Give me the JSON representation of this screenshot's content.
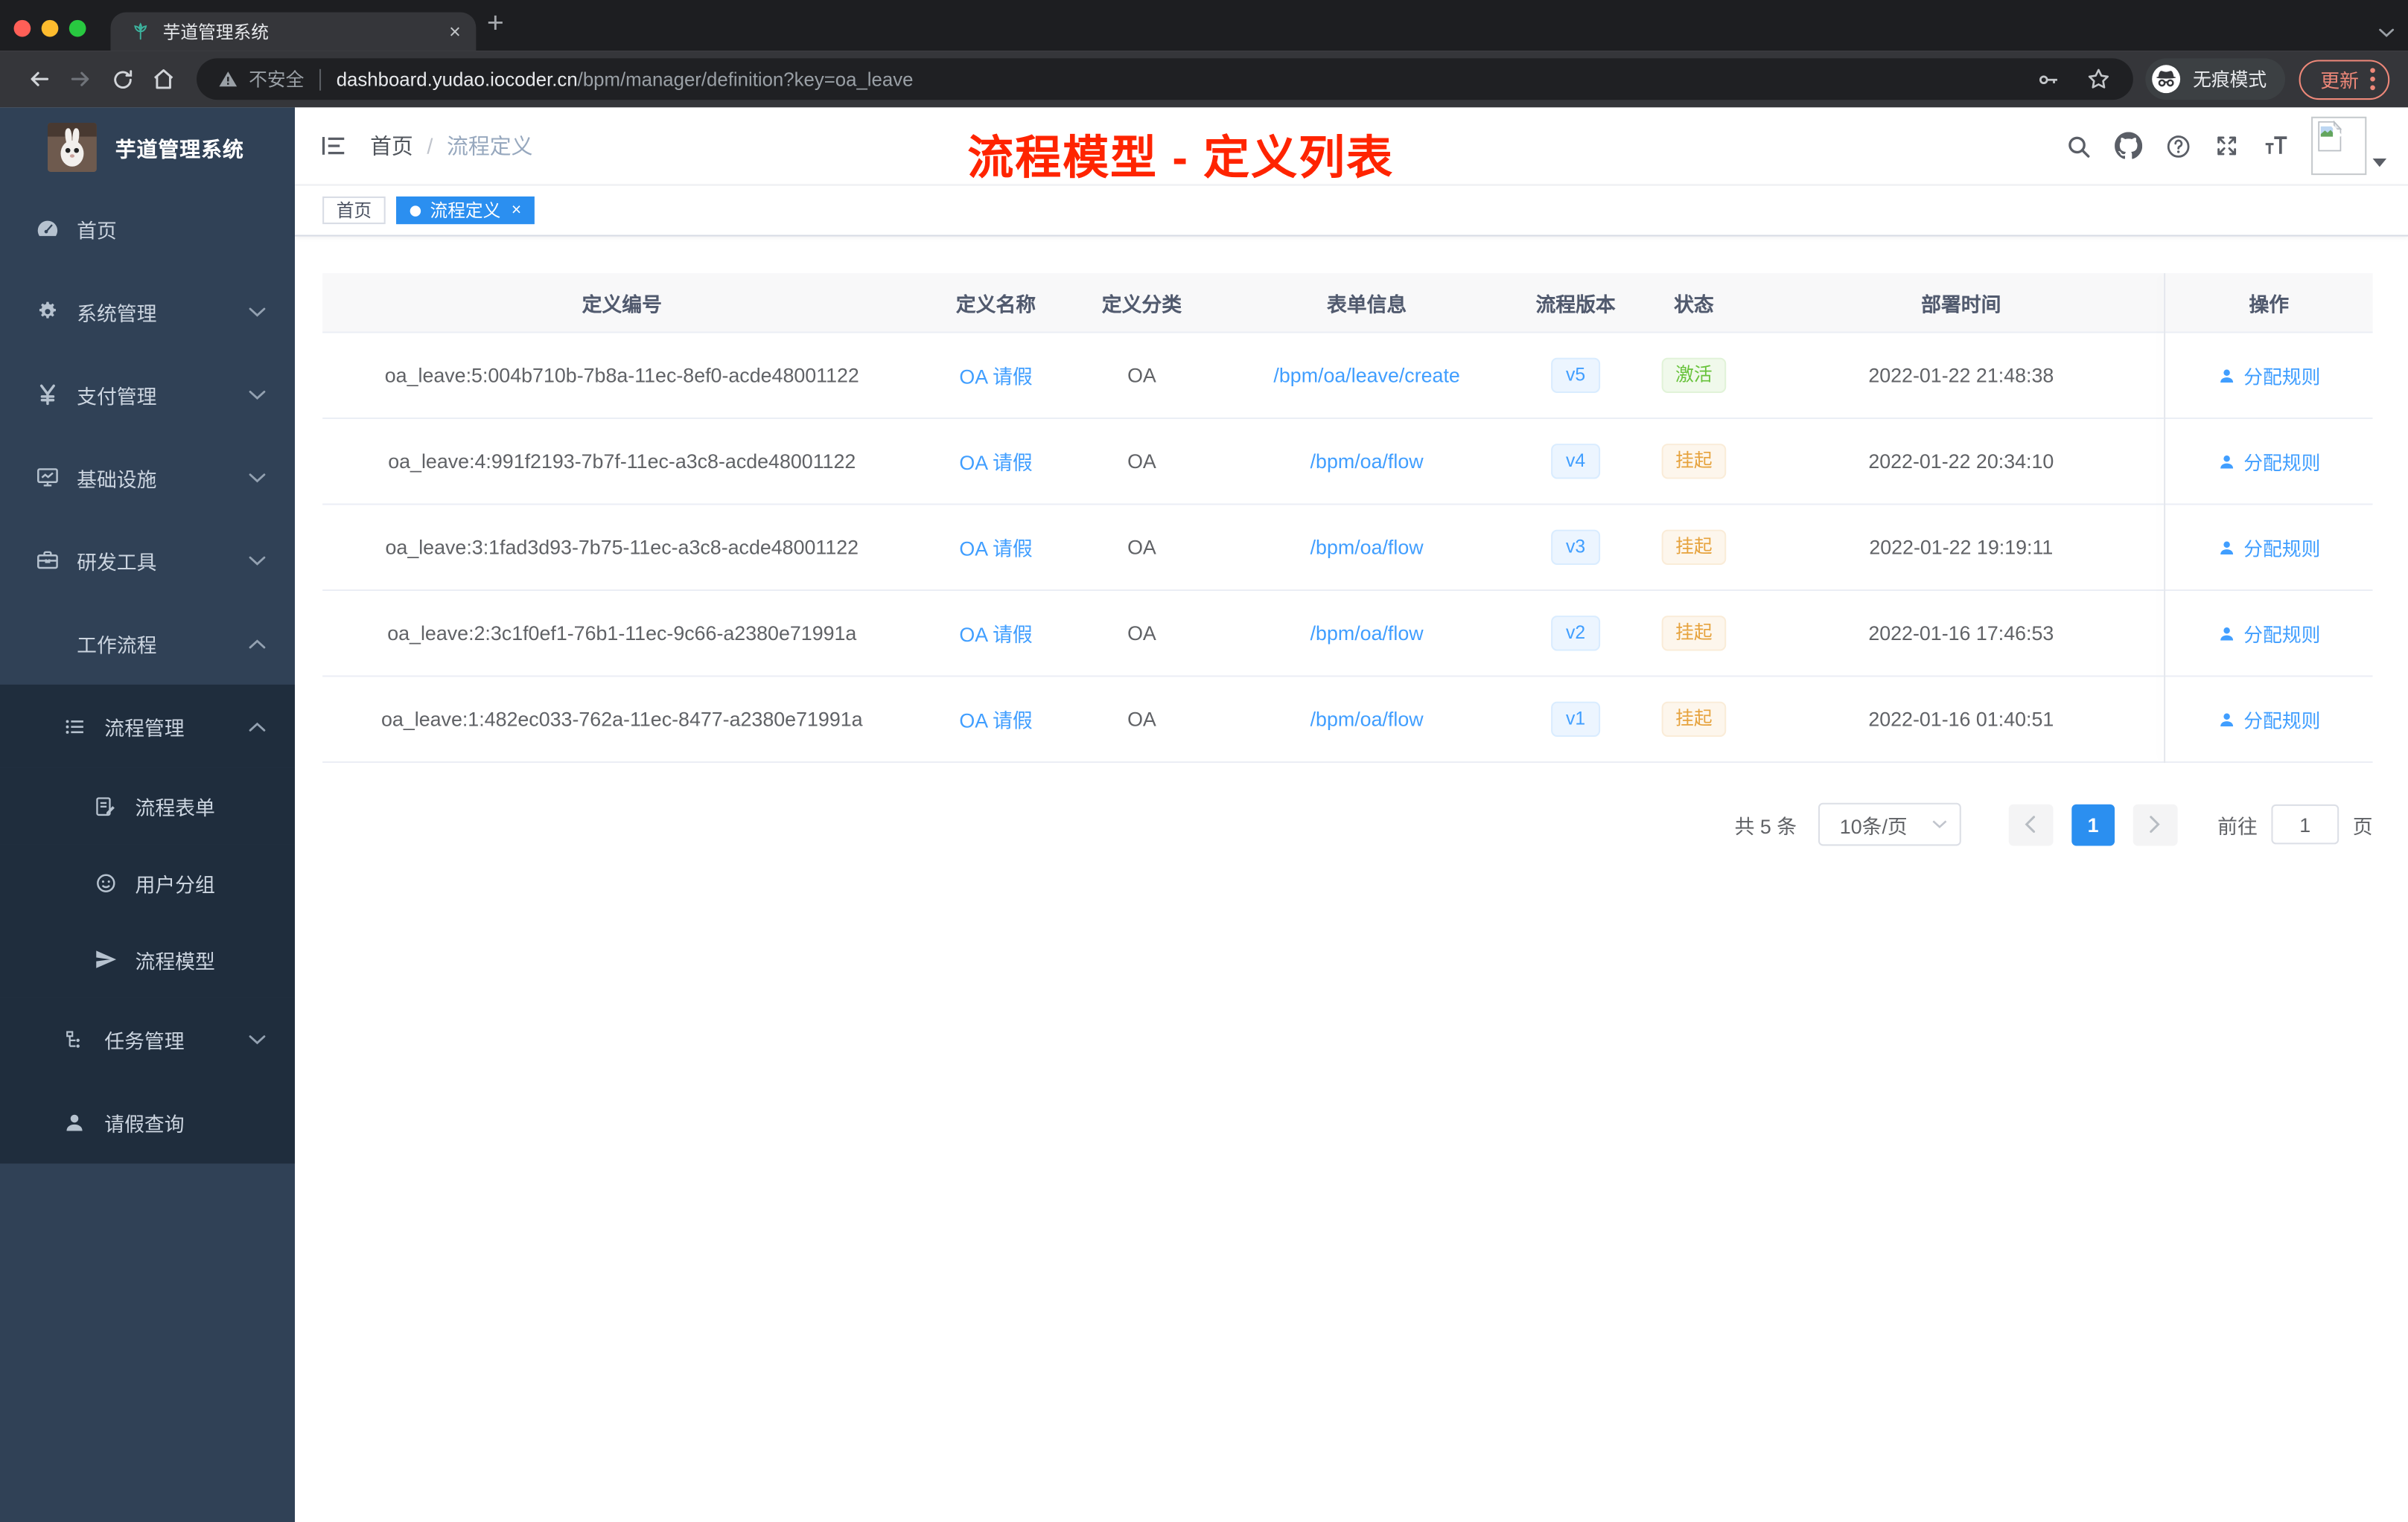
{
  "browser": {
    "traffic_lights": [
      "#ff5f57",
      "#febc2e",
      "#28c840"
    ],
    "tab": {
      "title": "芋道管理系统",
      "close": "×"
    },
    "new_tab": "+",
    "nav": {
      "secure_warning": "不安全",
      "host": "dashboard.yudao.iocoder.cn",
      "path": "/bpm/manager/definition?key=oa_leave"
    },
    "incognito_label": "无痕模式",
    "update_label": "更新"
  },
  "sidebar": {
    "title": "芋道管理系统",
    "items": [
      {
        "key": "home",
        "label": "首页",
        "icon": "dashboard-icon",
        "level": 1
      },
      {
        "key": "system-management",
        "label": "系统管理",
        "icon": "gear-icon",
        "level": 1,
        "chevron": "down"
      },
      {
        "key": "payment-management",
        "label": "支付管理",
        "icon": "yen-icon",
        "level": 1,
        "chevron": "down"
      },
      {
        "key": "infrastructure",
        "label": "基础设施",
        "icon": "monitor-icon",
        "level": 1,
        "chevron": "down"
      },
      {
        "key": "dev-tools",
        "label": "研发工具",
        "icon": "toolbox-icon",
        "level": 1,
        "chevron": "down"
      },
      {
        "key": "workflow",
        "label": "工作流程",
        "icon": "briefcase-icon",
        "level": 1,
        "chevron": "up"
      },
      {
        "key": "process-management",
        "label": "流程管理",
        "icon": "list-icon",
        "level": 2,
        "chevron": "up",
        "dark": true
      },
      {
        "key": "process-form",
        "label": "流程表单",
        "icon": "form-icon",
        "level": 3,
        "dark": true
      },
      {
        "key": "user-group",
        "label": "用户分组",
        "icon": "face-icon",
        "level": 3,
        "dark": true
      },
      {
        "key": "process-model",
        "label": "流程模型",
        "icon": "plane-icon",
        "level": 3,
        "dark": true
      },
      {
        "key": "task-management",
        "label": "任务管理",
        "icon": "tree-icon",
        "level": 2,
        "chevron": "down",
        "dark": true
      },
      {
        "key": "leave-query",
        "label": "请假查询",
        "icon": "person-icon",
        "level": 2,
        "dark": true
      }
    ]
  },
  "header": {
    "breadcrumb": {
      "root": "首页",
      "separator": "/",
      "current": "流程定义"
    },
    "annotation": "流程模型 - 定义列表"
  },
  "tags": [
    {
      "label": "首页",
      "active": false
    },
    {
      "label": "流程定义",
      "active": true
    }
  ],
  "table": {
    "columns": [
      "定义编号",
      "定义名称",
      "定义分类",
      "表单信息",
      "流程版本",
      "状态",
      "部署时间",
      "操作"
    ],
    "action_label": "分配规则",
    "rows": [
      {
        "id": "oa_leave:5:004b710b-7b8a-11ec-8ef0-acde48001122",
        "name": "OA 请假",
        "category": "OA",
        "form": "/bpm/oa/leave/create",
        "version": "v5",
        "status": "激活",
        "status_type": "success",
        "deployed": "2022-01-22 21:48:38"
      },
      {
        "id": "oa_leave:4:991f2193-7b7f-11ec-a3c8-acde48001122",
        "name": "OA 请假",
        "category": "OA",
        "form": "/bpm/oa/flow",
        "version": "v4",
        "status": "挂起",
        "status_type": "warning",
        "deployed": "2022-01-22 20:34:10"
      },
      {
        "id": "oa_leave:3:1fad3d93-7b75-11ec-a3c8-acde48001122",
        "name": "OA 请假",
        "category": "OA",
        "form": "/bpm/oa/flow",
        "version": "v3",
        "status": "挂起",
        "status_type": "warning",
        "deployed": "2022-01-22 19:19:11"
      },
      {
        "id": "oa_leave:2:3c1f0ef1-76b1-11ec-9c66-a2380e71991a",
        "name": "OA 请假",
        "category": "OA",
        "form": "/bpm/oa/flow",
        "version": "v2",
        "status": "挂起",
        "status_type": "warning",
        "deployed": "2022-01-16 17:46:53"
      },
      {
        "id": "oa_leave:1:482ec033-762a-11ec-8477-a2380e71991a",
        "name": "OA 请假",
        "category": "OA",
        "form": "/bpm/oa/flow",
        "version": "v1",
        "status": "挂起",
        "status_type": "warning",
        "deployed": "2022-01-16 01:40:51"
      }
    ]
  },
  "pagination": {
    "total": "共 5 条",
    "page_size": "10条/页",
    "page": "1",
    "goto": "前往",
    "unit": "页"
  },
  "colors": {
    "accent": "#2b8ff0",
    "link": "#409eff",
    "annotation_red": "#ff2400",
    "success": "#67c23a",
    "warning": "#e6a23c",
    "sidebar_bg": "#304156",
    "submenu_bg": "#1f2d3d",
    "version_tag_bg": "#ecf5ff",
    "status_success_bg": "#f0f9eb",
    "status_warning_bg": "#fdf6ec"
  }
}
